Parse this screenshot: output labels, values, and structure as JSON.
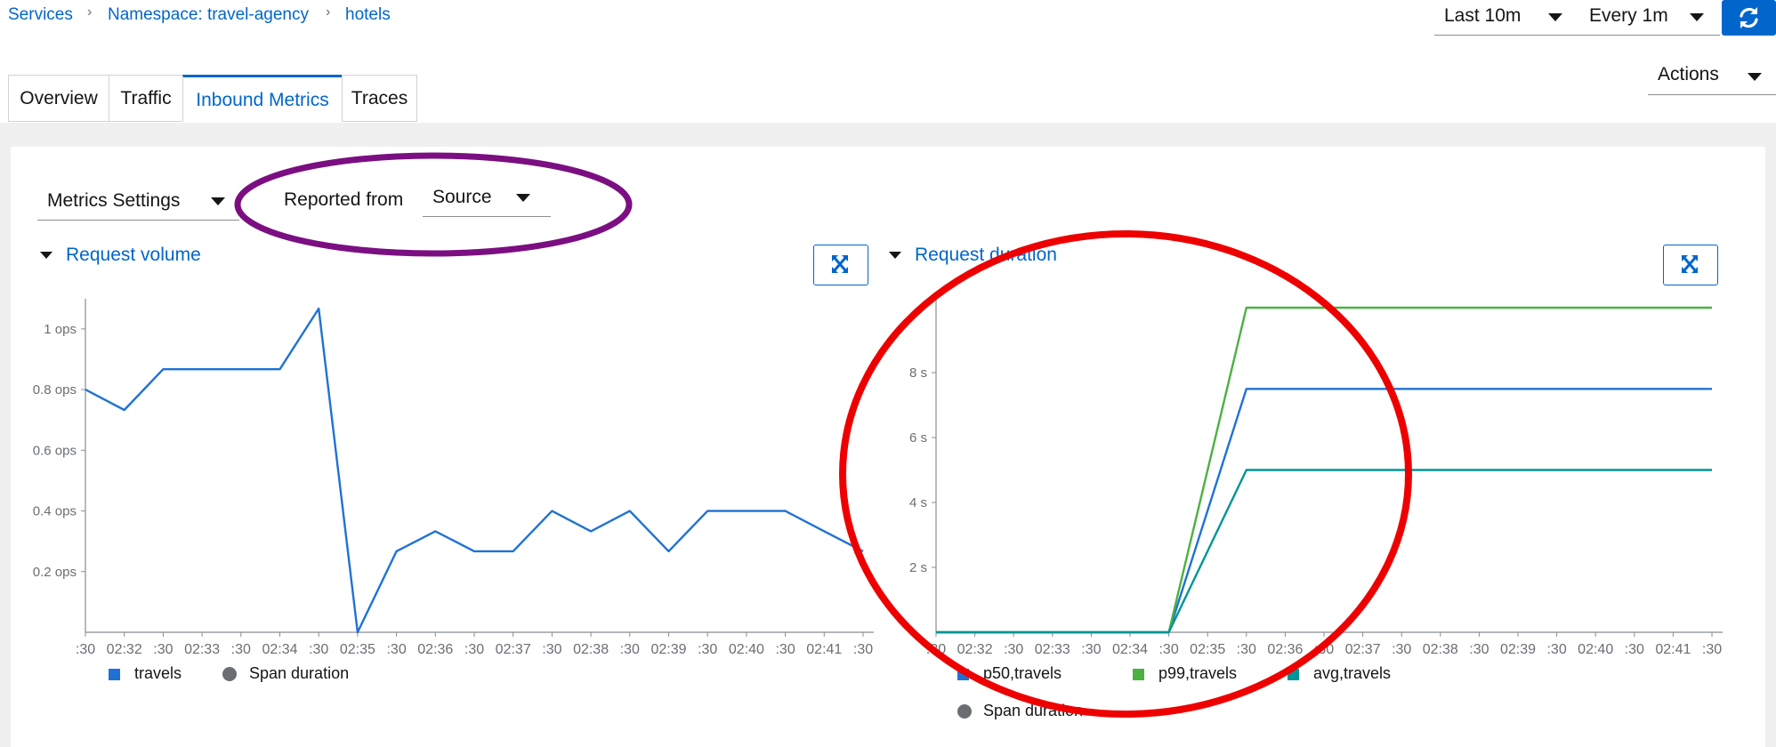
{
  "breadcrumb": {
    "services": "Services",
    "namespace": "Namespace: travel-agency",
    "current": "hotels"
  },
  "controls": {
    "time_range": "Last 10m",
    "refresh_interval": "Every 1m",
    "actions": "Actions"
  },
  "tabs": [
    "Overview",
    "Traffic",
    "Inbound Metrics",
    "Traces"
  ],
  "active_tab": "Inbound Metrics",
  "toolbar": {
    "metrics_settings": "Metrics Settings",
    "reported_from_label": "Reported from",
    "reported_from_value": "Source"
  },
  "colors": {
    "accent": "#0066cc",
    "series_blue": "#1f72d4",
    "series_green": "#4cb140",
    "series_teal": "#009596",
    "annotation_purple": "#7b0f82",
    "annotation_red": "#ee0000"
  },
  "chart_data": [
    {
      "type": "line",
      "title": "Request volume",
      "x_ticks": [
        ":30",
        "02:32",
        ":30",
        "02:33",
        ":30",
        "02:34",
        ":30",
        "02:35",
        ":30",
        "02:36",
        ":30",
        "02:37",
        ":30",
        "02:38",
        ":30",
        "02:39",
        ":30",
        "02:40",
        ":30",
        "02:41",
        ":30"
      ],
      "y_ticks": [
        "0.2 ops",
        "0.4 ops",
        "0.6 ops",
        "0.8 ops",
        "1 ops"
      ],
      "y_tick_values": [
        0.2,
        0.4,
        0.6,
        0.8,
        1.0
      ],
      "ylim": [
        0,
        1.07
      ],
      "series": [
        {
          "name": "travels",
          "color": "#1f72d4",
          "values": [
            0.8,
            0.733,
            0.867,
            0.867,
            0.867,
            0.867,
            1.067,
            0.0,
            0.267,
            0.333,
            0.267,
            0.267,
            0.4,
            0.333,
            0.4,
            0.267,
            0.4,
            0.4,
            0.4,
            0.333,
            0.267
          ]
        }
      ],
      "legend": [
        "travels",
        "Span duration"
      ]
    },
    {
      "type": "line",
      "title": "Request duration",
      "x_ticks": [
        ":30",
        "02:32",
        ":30",
        "02:33",
        ":30",
        "02:34",
        ":30",
        "02:35",
        ":30",
        "02:36",
        ":30",
        "02:37",
        ":30",
        "02:38",
        ":30",
        "02:39",
        ":30",
        "02:40",
        ":30",
        "02:41",
        ":30"
      ],
      "y_ticks": [
        "2 s",
        "4 s",
        "6 s",
        "8 s"
      ],
      "y_tick_values": [
        2,
        4,
        6,
        8
      ],
      "ylim": [
        0,
        10
      ],
      "series": [
        {
          "name": "p50,travels",
          "color": "#1f72d4",
          "values": [
            0,
            0,
            0,
            0,
            0,
            0,
            0,
            7.5,
            7.5,
            7.5,
            7.5,
            7.5,
            7.5,
            7.5,
            7.5,
            7.5,
            7.5,
            7.5,
            7.5,
            7.5,
            7.5,
            7.5
          ]
        },
        {
          "name": "p99,travels",
          "color": "#4cb140",
          "values": [
            0,
            0,
            0,
            0,
            0,
            0,
            0,
            10,
            10,
            10,
            10,
            10,
            10,
            10,
            10,
            10,
            10,
            10,
            10,
            10,
            10,
            10
          ]
        },
        {
          "name": "avg,travels",
          "color": "#009596",
          "values": [
            0,
            0,
            0,
            0,
            0,
            0,
            0,
            5.0,
            5.0,
            5.0,
            5.0,
            5.0,
            5.0,
            5.0,
            5.0,
            5.0,
            5.0,
            5.0,
            5.0,
            5.0,
            5.0,
            5.0
          ]
        }
      ],
      "legend": [
        "p50,travels",
        "p99,travels",
        "avg,travels",
        "Span duration"
      ]
    }
  ]
}
